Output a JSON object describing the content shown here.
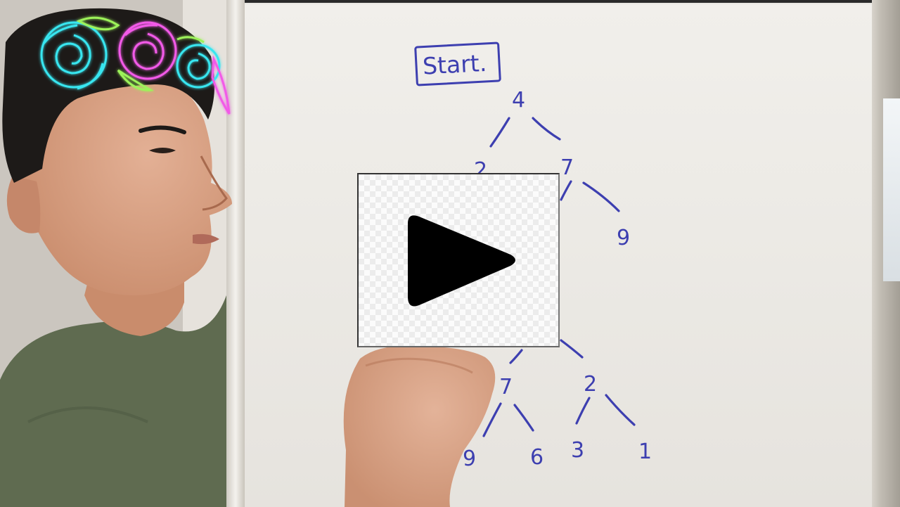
{
  "board": {
    "start_label": "Start.",
    "tree_top": {
      "root": "4",
      "left_child": "2",
      "right_child": "7",
      "right_grandchild": "9"
    },
    "tree_bottom": {
      "left_node": "7",
      "right_node": "2",
      "leaves": [
        "9",
        "6",
        "3",
        "1"
      ]
    }
  },
  "overlay": {
    "icon": "play-icon"
  },
  "colors": {
    "marker_blue": "#3d3fb0",
    "skin": "#d9a184",
    "shirt": "#5f6b50",
    "hair": "#1d1a18",
    "crown_cyan": "#38e6f0",
    "crown_pink": "#f25ae8",
    "crown_green": "#9df25a"
  }
}
